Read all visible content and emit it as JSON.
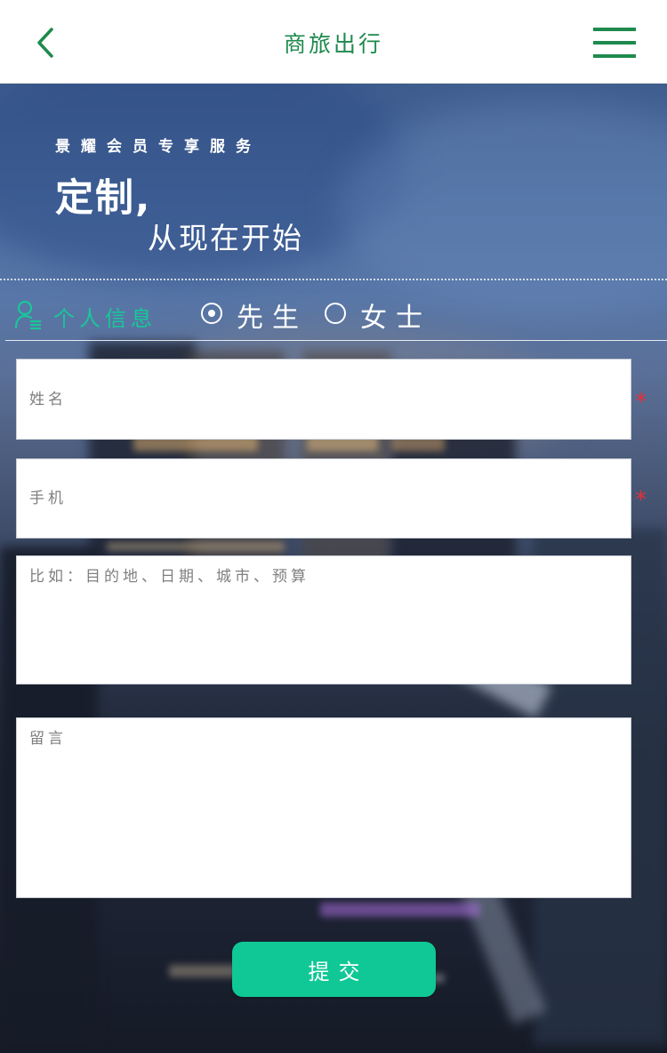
{
  "header": {
    "title": "商旅出行",
    "back_icon": "chevron-left-icon",
    "menu_icon": "hamburger-menu-icon"
  },
  "hero": {
    "subtitle": "景耀会员专享服务",
    "title_line1": "定制,",
    "title_line2": "从现在开始"
  },
  "personal_info": {
    "icon": "user-icon",
    "label": "个人信息",
    "gender_options": [
      {
        "label": "先生",
        "selected": true
      },
      {
        "label": "女士",
        "selected": false
      }
    ]
  },
  "form": {
    "name": {
      "placeholder": "姓名",
      "value": "",
      "required_mark": "*"
    },
    "phone": {
      "placeholder": "手机",
      "value": "",
      "required_mark": "*"
    },
    "detail": {
      "placeholder": "比如：目的地、日期、城市、预算",
      "value": ""
    },
    "message": {
      "placeholder": "留言",
      "value": ""
    }
  },
  "submit": {
    "label": "提交"
  },
  "colors": {
    "brand_green": "#1e8a4e",
    "accent_teal": "#18c799",
    "submit_bg": "#0fc896",
    "required_red": "#e52f3a"
  }
}
